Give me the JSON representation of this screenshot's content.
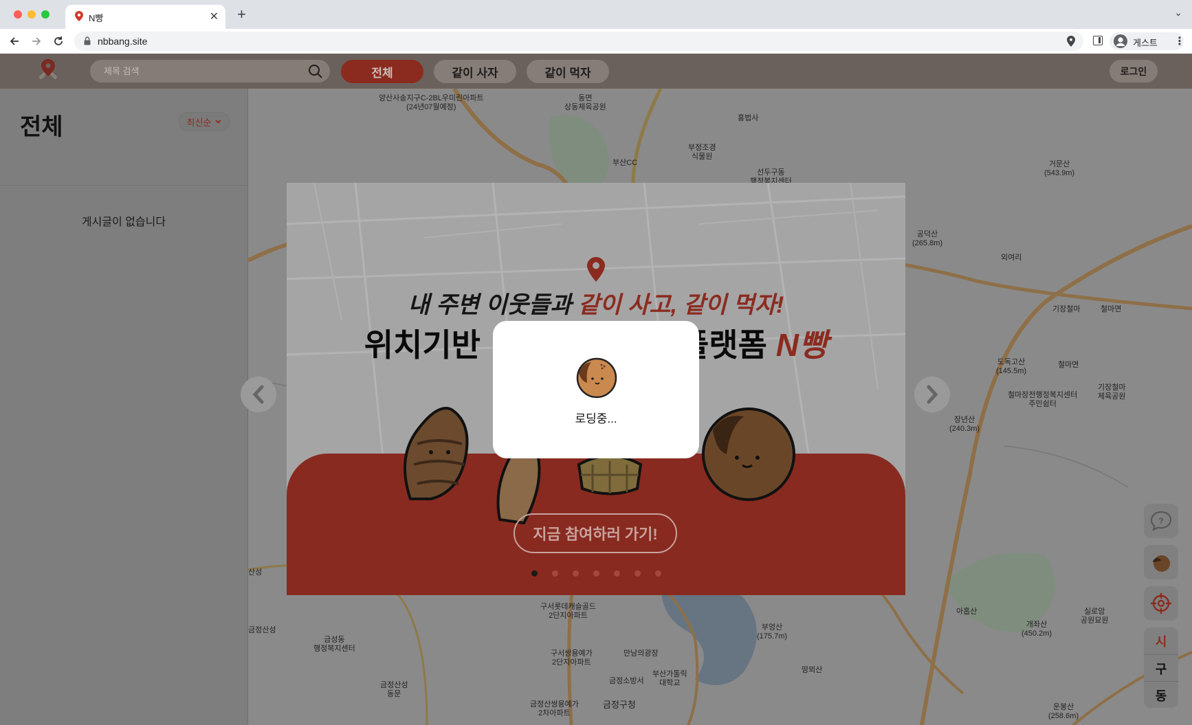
{
  "browser": {
    "tab_title": "N빵",
    "url": "nbbang.site",
    "profile_label": "게스트"
  },
  "header": {
    "search_placeholder": "제목 검색",
    "tabs": [
      {
        "label": "전체",
        "active": true
      },
      {
        "label": "같이 사자",
        "active": false
      },
      {
        "label": "같이 먹자",
        "active": false
      }
    ],
    "login_label": "로그인"
  },
  "sidebar": {
    "title": "전체",
    "sort_label": "최신순",
    "empty_message": "게시글이 없습니다"
  },
  "map": {
    "labels": [
      "양산사송지구C-2BL우미린아파트\n(24년07월예정)",
      "동면\n상동체육공원",
      "홍법사",
      "부정조경\n식물원",
      "부산CC",
      "선두구동\n행정복지센터",
      "거문산\n(543.9m)",
      "공덕산\n(265.8m)",
      "외여리",
      "기장철마",
      "철마면",
      "도독고산\n(145.5m)",
      "철마면",
      "철마장전행정복지센터\n주민쉼터",
      "기장철마\n체육공원",
      "장년산\n(240.3m)",
      "아홉산",
      "개좌산\n(450.2m)",
      "실로암\n공원묘원",
      "부엉산\n(175.7m)",
      "땅뫼산",
      "운봉산\n(258.6m)",
      "구서롯데캐슬골드\n2단지아파트",
      "구서쌍용예가\n2단지아파트",
      "만남의광장",
      "부산가톨릭\n대학교",
      "금정소방서",
      "금정산쌍용예가\n2차아파트",
      "금정구청",
      "금성동\n행정복지센터",
      "금정산성\n동문",
      "금정산성",
      "산성"
    ]
  },
  "map_controls": {
    "help_icon": "chat-help-icon",
    "bread_icon": "bread-character-icon",
    "location_icon": "crosshair-icon",
    "region_levels": [
      "시",
      "구",
      "동"
    ]
  },
  "banner": {
    "line1_prefix": "내 주변 이웃들과 ",
    "line1_highlight": "같이 사고, 같이 먹자!",
    "line2_prefix": "위치기반",
    "line2_suffix": "플랫폼 ",
    "line2_highlight": "N빵",
    "cta_label": "지금 참여하러 가기!",
    "slide_count": 7,
    "active_slide": 0
  },
  "loading": {
    "text": "로딩중..."
  },
  "colors": {
    "brand_red": "#8b2b1f",
    "header_bg": "#6b615c",
    "overlay_dim": "#808080"
  }
}
